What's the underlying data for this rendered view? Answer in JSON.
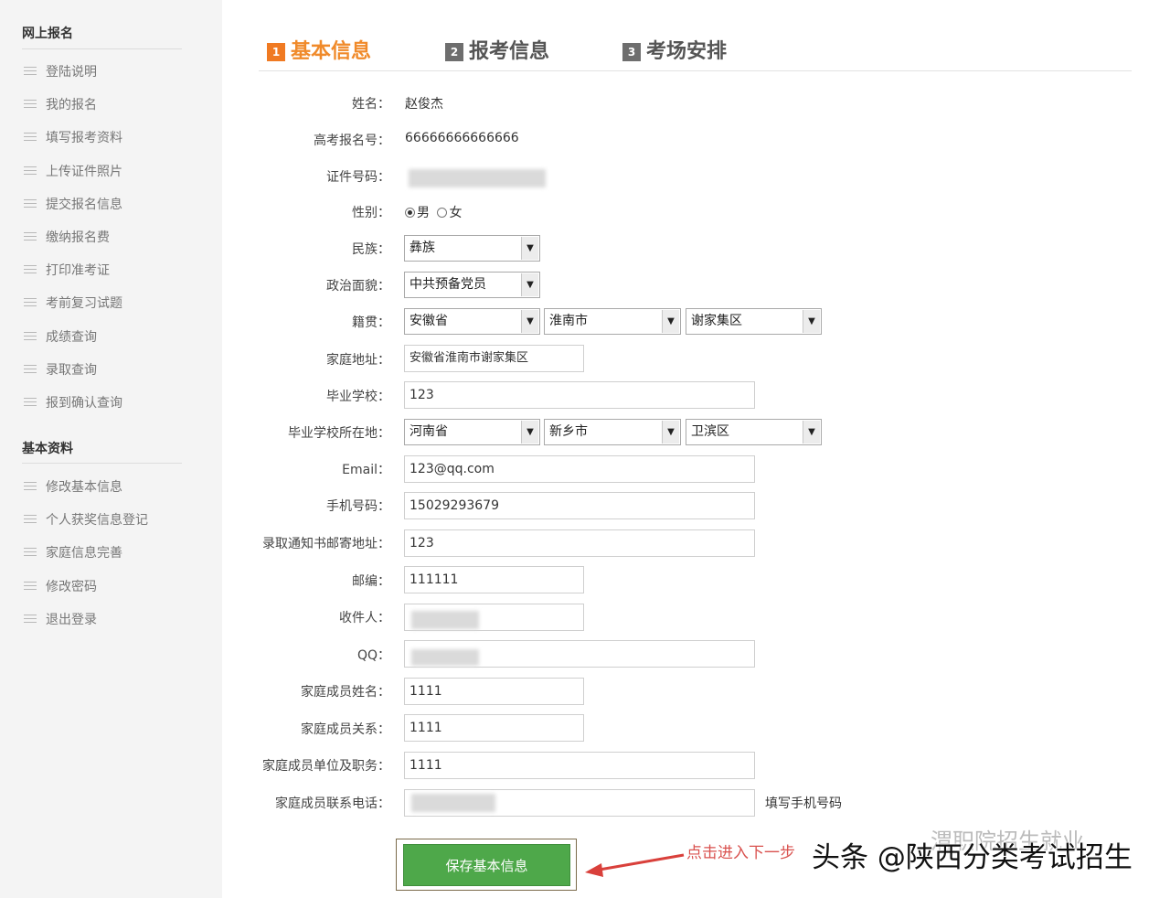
{
  "sidebar": {
    "section1_title": "网上报名",
    "section1_items": [
      {
        "label": "登陆说明"
      },
      {
        "label": "我的报名"
      },
      {
        "label": "填写报考资料"
      },
      {
        "label": "上传证件照片"
      },
      {
        "label": "提交报名信息"
      },
      {
        "label": "缴纳报名费"
      },
      {
        "label": "打印准考证"
      },
      {
        "label": "考前复习试题"
      },
      {
        "label": "成绩查询"
      },
      {
        "label": "录取查询"
      },
      {
        "label": "报到确认查询"
      }
    ],
    "section2_title": "基本资料",
    "section2_items": [
      {
        "label": "修改基本信息"
      },
      {
        "label": "个人获奖信息登记"
      },
      {
        "label": "家庭信息完善"
      },
      {
        "label": "修改密码"
      },
      {
        "label": "退出登录"
      }
    ]
  },
  "tabs": [
    {
      "num": "1",
      "label": "基本信息"
    },
    {
      "num": "2",
      "label": "报考信息"
    },
    {
      "num": "3",
      "label": "考场安排"
    }
  ],
  "form": {
    "name_label": "姓名：",
    "name_value": "赵俊杰",
    "regno_label": "高考报名号：",
    "regno_value": "66666666666666",
    "idno_label": "证件号码：",
    "gender_label": "性别：",
    "gender_male": "男",
    "gender_female": "女",
    "ethnic_label": "民族：",
    "ethnic_value": "彝族",
    "political_label": "政治面貌：",
    "political_value": "中共预备党员",
    "native_label": "籍贯：",
    "native_province": "安徽省",
    "native_city": "淮南市",
    "native_district": "谢家集区",
    "address_label": "家庭地址：",
    "address_value": "安徽省淮南市谢家集区",
    "school_label": "毕业学校：",
    "school_value": "123",
    "school_loc_label": "毕业学校所在地：",
    "school_province": "河南省",
    "school_city": "新乡市",
    "school_district": "卫滨区",
    "email_label": "Email：",
    "email_value": "123@qq.com",
    "phone_label": "手机号码：",
    "phone_value": "15029293679",
    "mail_addr_label": "录取通知书邮寄地址：",
    "mail_addr_value": "123",
    "postcode_label": "邮编：",
    "postcode_value": "111111",
    "recipient_label": "收件人：",
    "qq_label": "QQ：",
    "family_name_label": "家庭成员姓名：",
    "family_name_value": "1111",
    "family_rel_label": "家庭成员关系：",
    "family_rel_value": "1111",
    "family_job_label": "家庭成员单位及职务：",
    "family_job_value": "1111",
    "family_phone_label": "家庭成员联系电话：",
    "family_phone_hint": "填写手机号码"
  },
  "save_label": "保存基本信息",
  "annotation": "点击进入下一步",
  "watermark": "头条 @陕西分类考试招生",
  "watermark_faint": "渭职院招生就业"
}
